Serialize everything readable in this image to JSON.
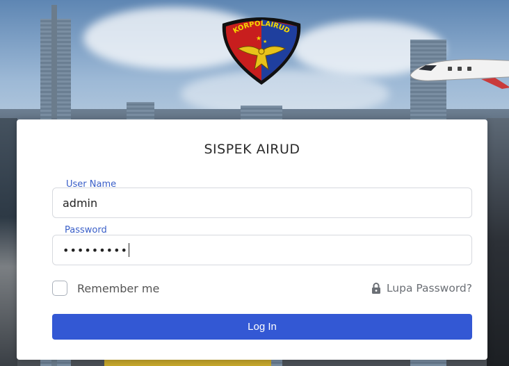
{
  "logo": {
    "text": "KORPOLAIRUD"
  },
  "login": {
    "title": "SISPEK AIRUD",
    "username": {
      "label": "User Name",
      "value": "admin"
    },
    "password": {
      "label": "Password",
      "masked_value": "•••••••••"
    },
    "remember_label": "Remember me",
    "remember_checked": false,
    "forgot_label": "Lupa Password?",
    "submit_label": "Log In"
  },
  "colors": {
    "accent": "#3358d4",
    "label": "#3a5fc8"
  },
  "icons": {
    "forgot": "lock-icon",
    "logo": "korpolairud-emblem"
  }
}
